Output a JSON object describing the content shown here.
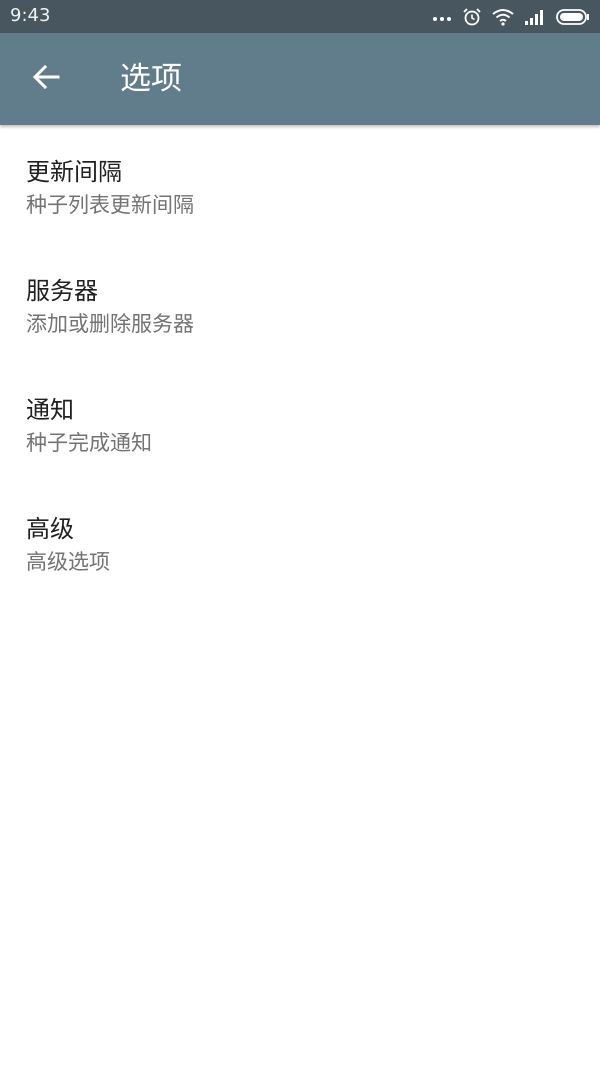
{
  "status_bar": {
    "time": "9:43",
    "icons": [
      "more-dots-icon",
      "alarm-clock-icon",
      "wifi-icon",
      "signal-icon",
      "battery-icon"
    ]
  },
  "app_bar": {
    "title": "选项",
    "back_icon": "arrow-left-icon",
    "color": "#617d8b"
  },
  "settings": {
    "items": [
      {
        "title": "更新间隔",
        "summary": "种子列表更新间隔"
      },
      {
        "title": "服务器",
        "summary": "添加或删除服务器"
      },
      {
        "title": "通知",
        "summary": "种子完成通知"
      },
      {
        "title": "高级",
        "summary": "高级选项"
      }
    ]
  }
}
